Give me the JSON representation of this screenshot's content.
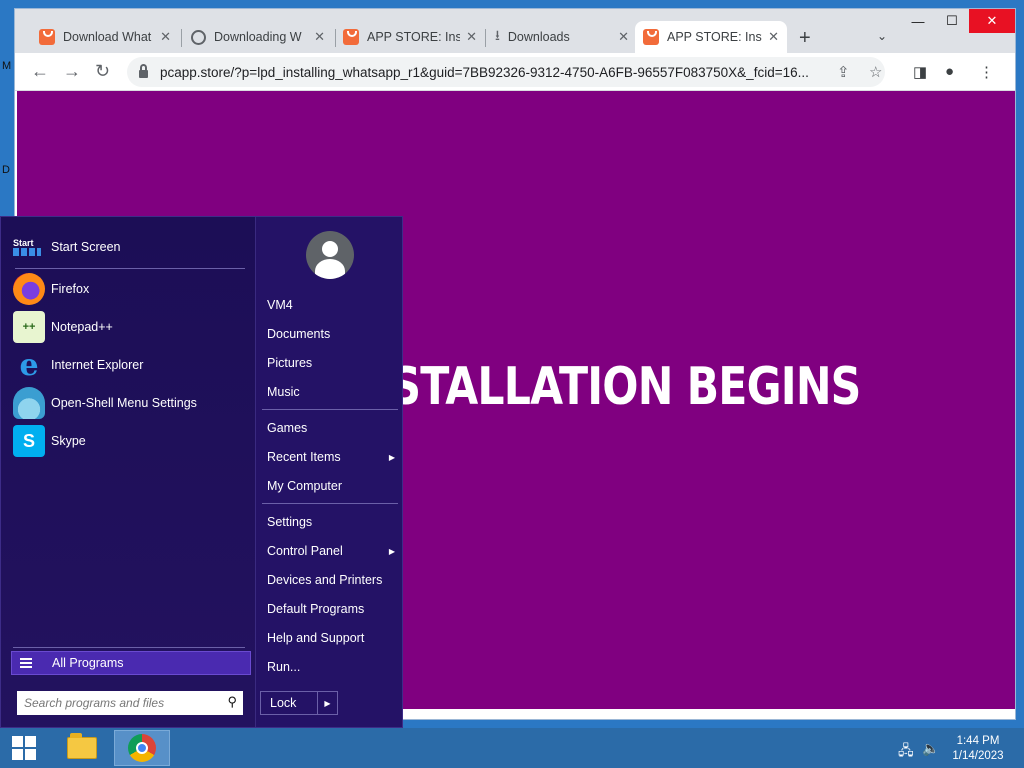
{
  "browser": {
    "tabs": [
      {
        "title": "Download What",
        "icon": "orange-bag-icon",
        "active": false
      },
      {
        "title": "Downloading W",
        "icon": "globe-icon",
        "active": false
      },
      {
        "title": "APP STORE: Insta",
        "icon": "orange-bag-icon",
        "active": false
      },
      {
        "title": "Downloads",
        "icon": "download-icon",
        "active": false
      },
      {
        "title": "APP STORE: Insta",
        "icon": "orange-bag-icon",
        "active": true
      }
    ],
    "url": "pcapp.store/?p=lpd_installing_whatsapp_r1&guid=7BB92326-9312-4750-A6FB-96557F083750X&_fcid=16...",
    "page_headline": "THE INSTALLATION BEGINS",
    "page_bg": "#800080"
  },
  "start_menu": {
    "pinned": [
      {
        "label": "Start Screen",
        "icon": "start-screen-icon"
      },
      {
        "label": "Firefox",
        "icon": "firefox-icon"
      },
      {
        "label": "Notepad++",
        "icon": "notepad-plus-plus-icon"
      },
      {
        "label": "Internet Explorer",
        "icon": "internet-explorer-icon"
      },
      {
        "label": "Open-Shell Menu Settings",
        "icon": "open-shell-icon"
      },
      {
        "label": "Skype",
        "icon": "skype-icon"
      }
    ],
    "start_icon_text": "Start",
    "all_programs": "All Programs",
    "search_placeholder": "Search programs and files",
    "right_items": [
      {
        "label": "VM4",
        "submenu": false
      },
      {
        "label": "Documents",
        "submenu": false
      },
      {
        "label": "Pictures",
        "submenu": false
      },
      {
        "label": "Music",
        "submenu": false
      },
      {
        "label": "Games",
        "submenu": false
      },
      {
        "label": "Recent Items",
        "submenu": true
      },
      {
        "label": "My Computer",
        "submenu": false
      },
      {
        "label": "Settings",
        "submenu": false
      },
      {
        "label": "Control Panel",
        "submenu": true
      },
      {
        "label": "Devices and Printers",
        "submenu": false
      },
      {
        "label": "Default Programs",
        "submenu": false
      },
      {
        "label": "Help and Support",
        "submenu": false
      },
      {
        "label": "Run...",
        "submenu": false
      }
    ],
    "lock_label": "Lock"
  },
  "taskbar": {
    "time": "1:44 PM",
    "date": "1/14/2023",
    "apps": [
      {
        "name": "file-explorer-icon",
        "active": false
      },
      {
        "name": "chrome-icon",
        "active": true
      }
    ]
  }
}
